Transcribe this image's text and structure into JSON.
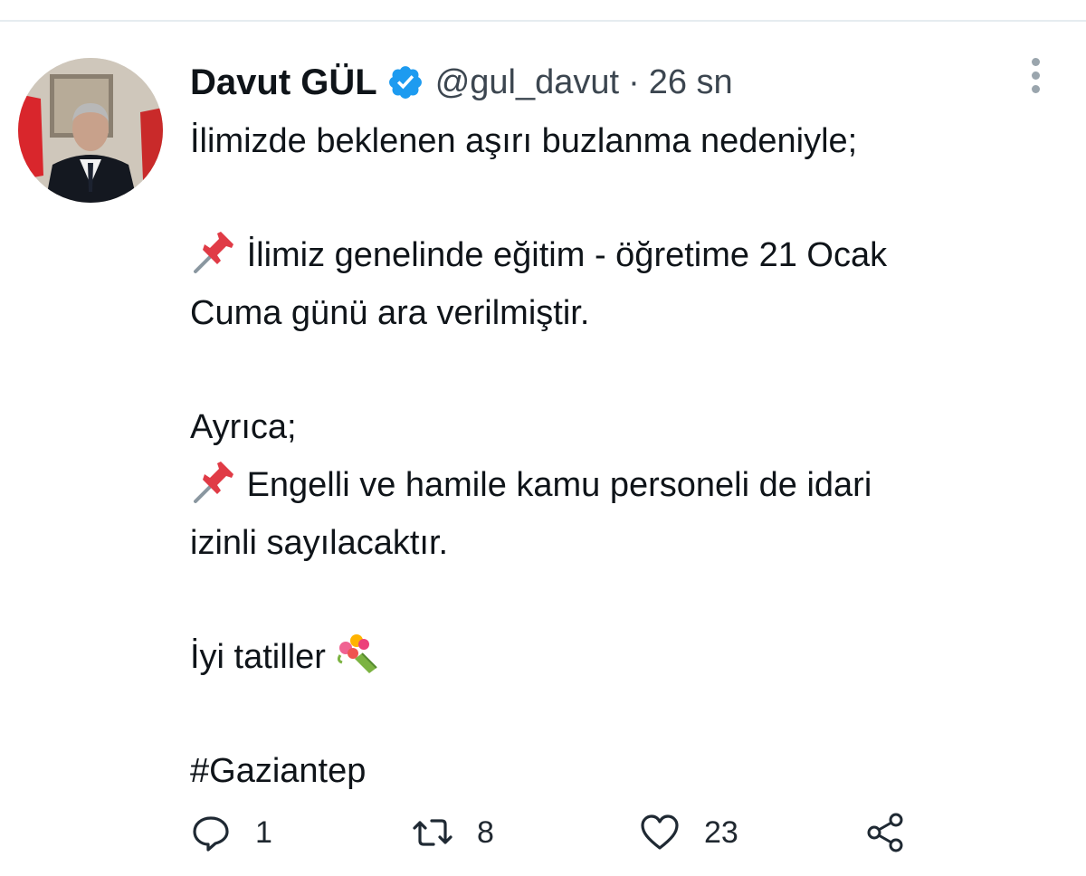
{
  "tweet": {
    "author_name": "Davut GÜL",
    "handle": "@gul_davut",
    "separator": "·",
    "time": "26 sn",
    "lines": {
      "l1": "İlimizde beklenen aşırı buzlanma nedeniyle;",
      "l2": "İlimiz genelinde eğitim - öğretime 21 Ocak",
      "l3": "Cuma günü ara verilmiştir.",
      "l4": "Ayrıca;",
      "l5": "Engelli ve hamile kamu personeli de idari",
      "l6": "izinli sayılacaktır.",
      "l7": "İyi tatiller",
      "l8": "#Gaziantep"
    },
    "icons": {
      "verified": "verified-badge-icon",
      "pin": "pushpin-icon",
      "flowers": "bouquet-icon",
      "reply": "reply-icon",
      "retweet": "retweet-icon",
      "like": "heart-icon",
      "share": "share-icon",
      "more": "more-icon"
    },
    "stats": {
      "replies": "1",
      "retweets": "8",
      "likes": "23"
    },
    "colors": {
      "verified": "#1d9bf0",
      "text": "#0f1419",
      "secondary": "#3c4650"
    }
  }
}
